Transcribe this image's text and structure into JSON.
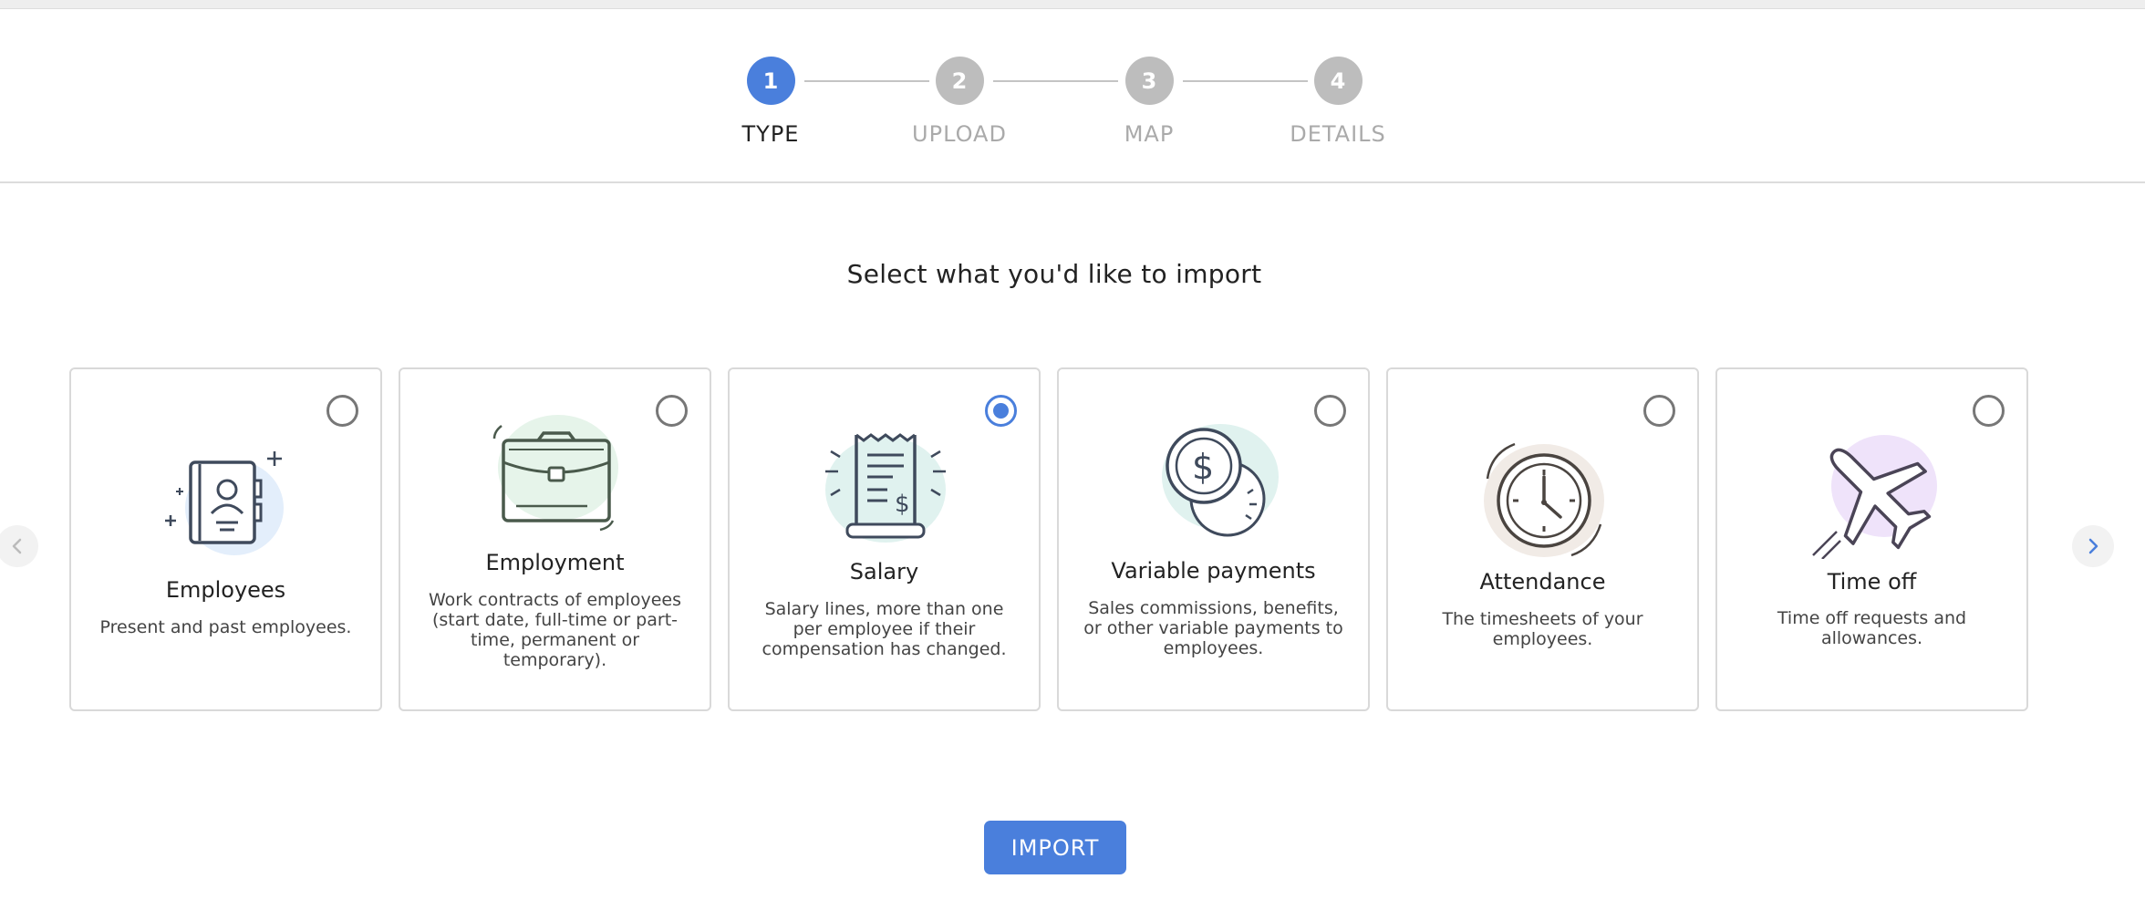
{
  "stepper": {
    "steps": [
      {
        "number": "1",
        "label": "TYPE",
        "state": "active"
      },
      {
        "number": "2",
        "label": "UPLOAD",
        "state": "inactive"
      },
      {
        "number": "3",
        "label": "MAP",
        "state": "inactive"
      },
      {
        "number": "4",
        "label": "DETAILS",
        "state": "inactive"
      }
    ]
  },
  "main": {
    "heading": "Select what you'd like to import",
    "options": [
      {
        "title": "Employees",
        "description": "Present and past employees.",
        "icon": "address-book-icon",
        "selected": false
      },
      {
        "title": "Employment",
        "description": "Work contracts of employees (start date, full-time or part-time, permanent or temporary).",
        "icon": "briefcase-icon",
        "selected": false
      },
      {
        "title": "Salary",
        "description": "Salary lines, more than one per employee if their compensation has changed.",
        "icon": "receipt-icon",
        "selected": true
      },
      {
        "title": "Variable payments",
        "description": "Sales commissions, benefits, or other variable payments to employees.",
        "icon": "coins-icon",
        "selected": false
      },
      {
        "title": "Attendance",
        "description": "The timesheets of your employees.",
        "icon": "clock-icon",
        "selected": false
      },
      {
        "title": "Time off",
        "description": "Time off requests and allowances.",
        "icon": "airplane-icon",
        "selected": false
      }
    ],
    "import_button": "IMPORT"
  },
  "colors": {
    "accent": "#4a7fdc",
    "inactive_step": "#bdbdbd",
    "blob_blue": "#e3eefb",
    "blob_green": "#e6f4ea",
    "blob_teal": "#e0f2ef",
    "blob_beige": "#f1ebe6",
    "blob_purple": "#efe3fa"
  }
}
